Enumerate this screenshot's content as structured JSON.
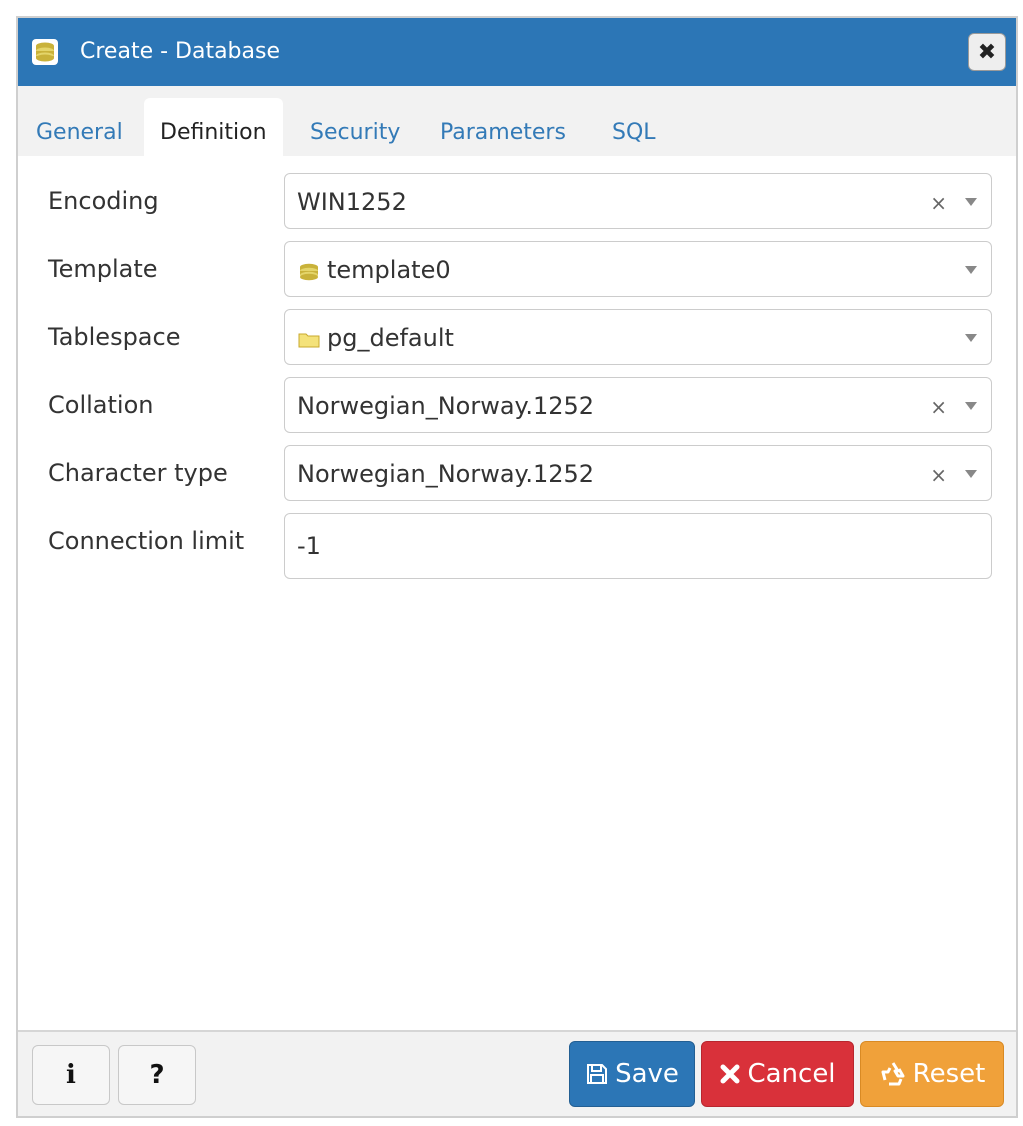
{
  "window": {
    "title": "Create - Database",
    "title_icon": "database-icon",
    "close_label": "✖"
  },
  "tabs": [
    {
      "label": "General",
      "active": false
    },
    {
      "label": "Definition",
      "active": true
    },
    {
      "label": "Security",
      "active": false
    },
    {
      "label": "Parameters",
      "active": false
    },
    {
      "label": "SQL",
      "active": false
    }
  ],
  "form": {
    "encoding": {
      "label": "Encoding",
      "value": "WIN1252",
      "clearable": true
    },
    "template": {
      "label": "Template",
      "value": "template0",
      "icon": "database-icon",
      "clearable": false
    },
    "tablespace": {
      "label": "Tablespace",
      "value": "pg_default",
      "icon": "folder-icon",
      "clearable": false
    },
    "collation": {
      "label": "Collation",
      "value": "Norwegian_Norway.1252",
      "clearable": true
    },
    "character_type": {
      "label": "Character type",
      "value": "Norwegian_Norway.1252",
      "clearable": true
    },
    "connection_limit": {
      "label": "Connection limit",
      "value": "-1"
    }
  },
  "clear_glyph": "×",
  "footer": {
    "info_label": "i",
    "help_label": "?",
    "save_label": "Save",
    "cancel_label": "Cancel",
    "reset_label": "Reset"
  },
  "colors": {
    "titlebar": "#2c76b6",
    "save": "#2c76b6",
    "cancel": "#d9313a",
    "reset": "#f0a13a",
    "tab_link": "#337ab7"
  }
}
